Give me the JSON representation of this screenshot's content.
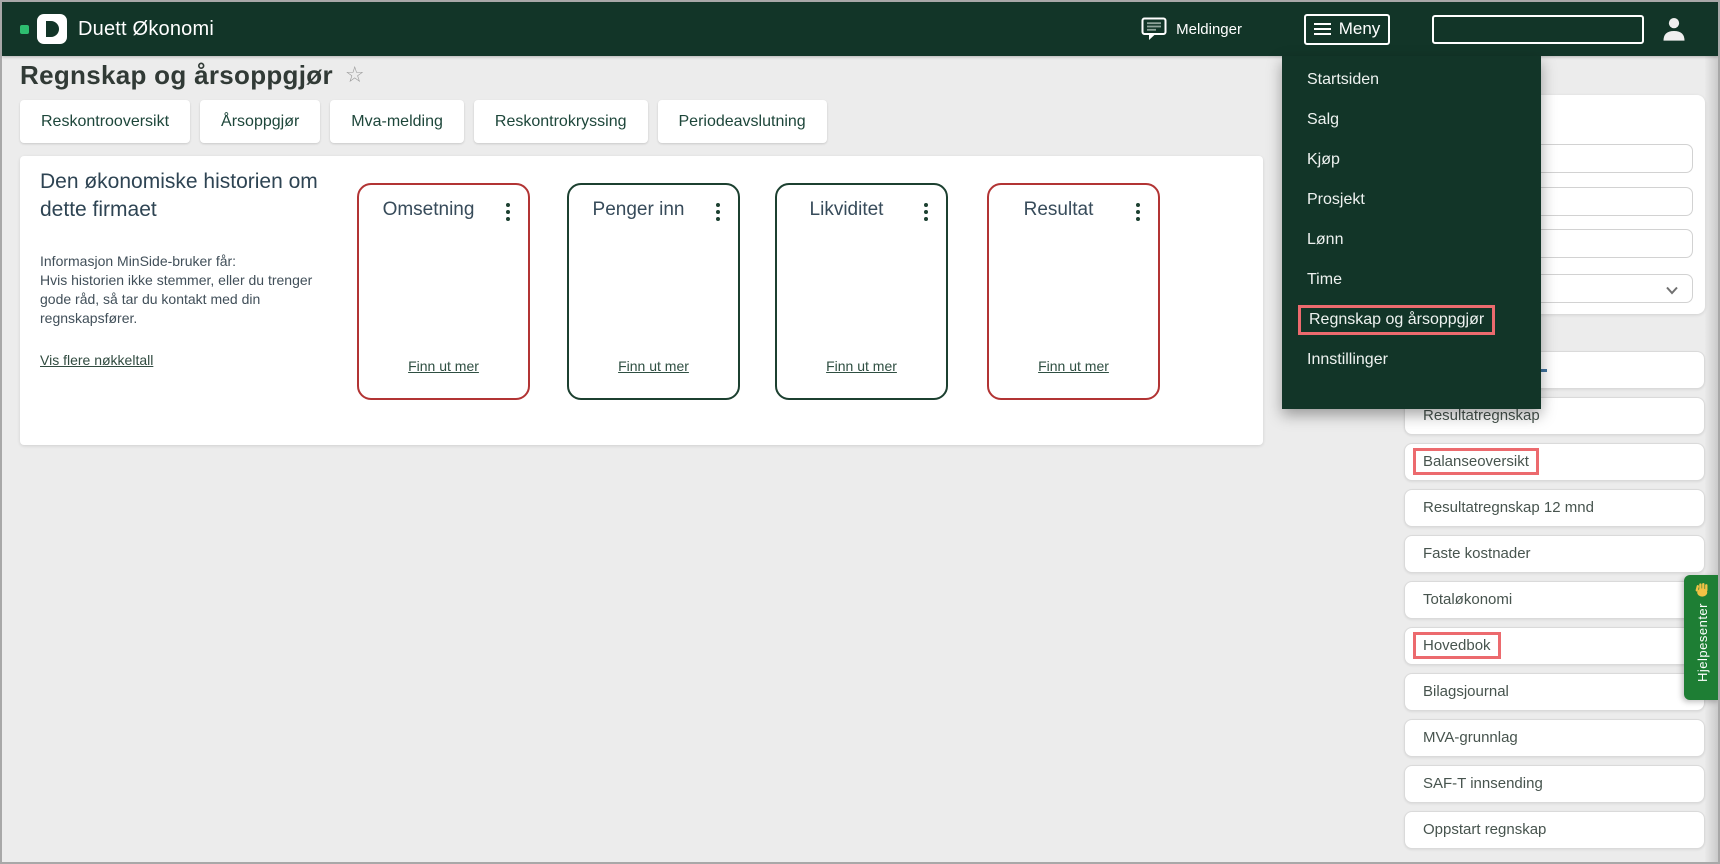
{
  "colors": {
    "header_bg": "#123528",
    "logo_accent_green": "#2ebd70",
    "card_border_red": "#b23434",
    "card_border_green": "#1c4030",
    "annotation_red": "#ec6a6e",
    "help_tab_green": "#1e7e34",
    "help_hand_yellow": "#f2c245",
    "page_background": "#ececec"
  },
  "header": {
    "brand": "Duett Økonomi",
    "messages_label": "Meldinger",
    "menu_label": "Meny",
    "search_value": "",
    "icons": [
      "message-icon",
      "hamburger-icon",
      "user-icon"
    ]
  },
  "page": {
    "title": "Regnskap og årsoppgjør",
    "favorite_icon": "star-icon",
    "tabs": [
      {
        "label": "Reskontrooversikt"
      },
      {
        "label": "Årsoppgjør"
      },
      {
        "label": "Mva-melding"
      },
      {
        "label": "Reskontrokryssing"
      },
      {
        "label": "Periodeavslutning"
      }
    ]
  },
  "story_panel": {
    "heading": "Den økonomiske historien om\ndette firmaet",
    "body": "Informasjon MinSide-bruker får:\nHvis historien ikke stemmer, eller du trenger\ngode råd, så tar du kontakt med din\nregnskapsfører.",
    "link_label": "Vis flere nøkkeltall",
    "cards": [
      {
        "title": "Omsetning",
        "link_label": "Finn ut mer",
        "border_color": "#b23434",
        "menu_icon": "kebab-menu-icon"
      },
      {
        "title": "Penger inn",
        "link_label": "Finn ut mer",
        "border_color": "#1c4030",
        "menu_icon": "kebab-menu-icon"
      },
      {
        "title": "Likviditet",
        "link_label": "Finn ut mer",
        "border_color": "#1c4030",
        "menu_icon": "kebab-menu-icon"
      },
      {
        "title": "Resultat",
        "link_label": "Finn ut mer",
        "border_color": "#b23434",
        "menu_icon": "kebab-menu-icon"
      }
    ]
  },
  "menu_dropdown": {
    "items": [
      {
        "label": "Startsiden",
        "highlighted": false
      },
      {
        "label": "Salg",
        "highlighted": false
      },
      {
        "label": "Kjøp",
        "highlighted": false
      },
      {
        "label": "Prosjekt",
        "highlighted": false
      },
      {
        "label": "Lønn",
        "highlighted": false
      },
      {
        "label": "Time",
        "highlighted": false
      },
      {
        "label": "Regnskap og årsoppgjør",
        "highlighted": true
      },
      {
        "label": "Innstillinger",
        "highlighted": false
      }
    ]
  },
  "right_panel": {
    "inputs": [
      {
        "value": ""
      },
      {
        "value": ""
      },
      {
        "value": ""
      }
    ],
    "select": {
      "value": "",
      "icon": "chevron-down-icon"
    },
    "rows": [
      {
        "label": "",
        "fragment": "-",
        "highlighted": false
      },
      {
        "label": "Resultatregnskap",
        "highlighted": false
      },
      {
        "label": "Balanseoversikt",
        "highlighted": true
      },
      {
        "label": "Resultatregnskap 12 mnd",
        "highlighted": false
      },
      {
        "label": "Faste kostnader",
        "highlighted": false
      },
      {
        "label": "Totaløkonomi",
        "highlighted": false
      },
      {
        "label": "Hovedbok",
        "highlighted": true
      },
      {
        "label": "Bilagsjournal",
        "highlighted": false
      },
      {
        "label": "MVA-grunnlag",
        "highlighted": false
      },
      {
        "label": "SAF-T innsending",
        "highlighted": false
      },
      {
        "label": "Oppstart regnskap",
        "highlighted": false
      }
    ]
  },
  "help_tab": {
    "label": "Hjelpesenter",
    "icon": "waving-hand-icon"
  }
}
